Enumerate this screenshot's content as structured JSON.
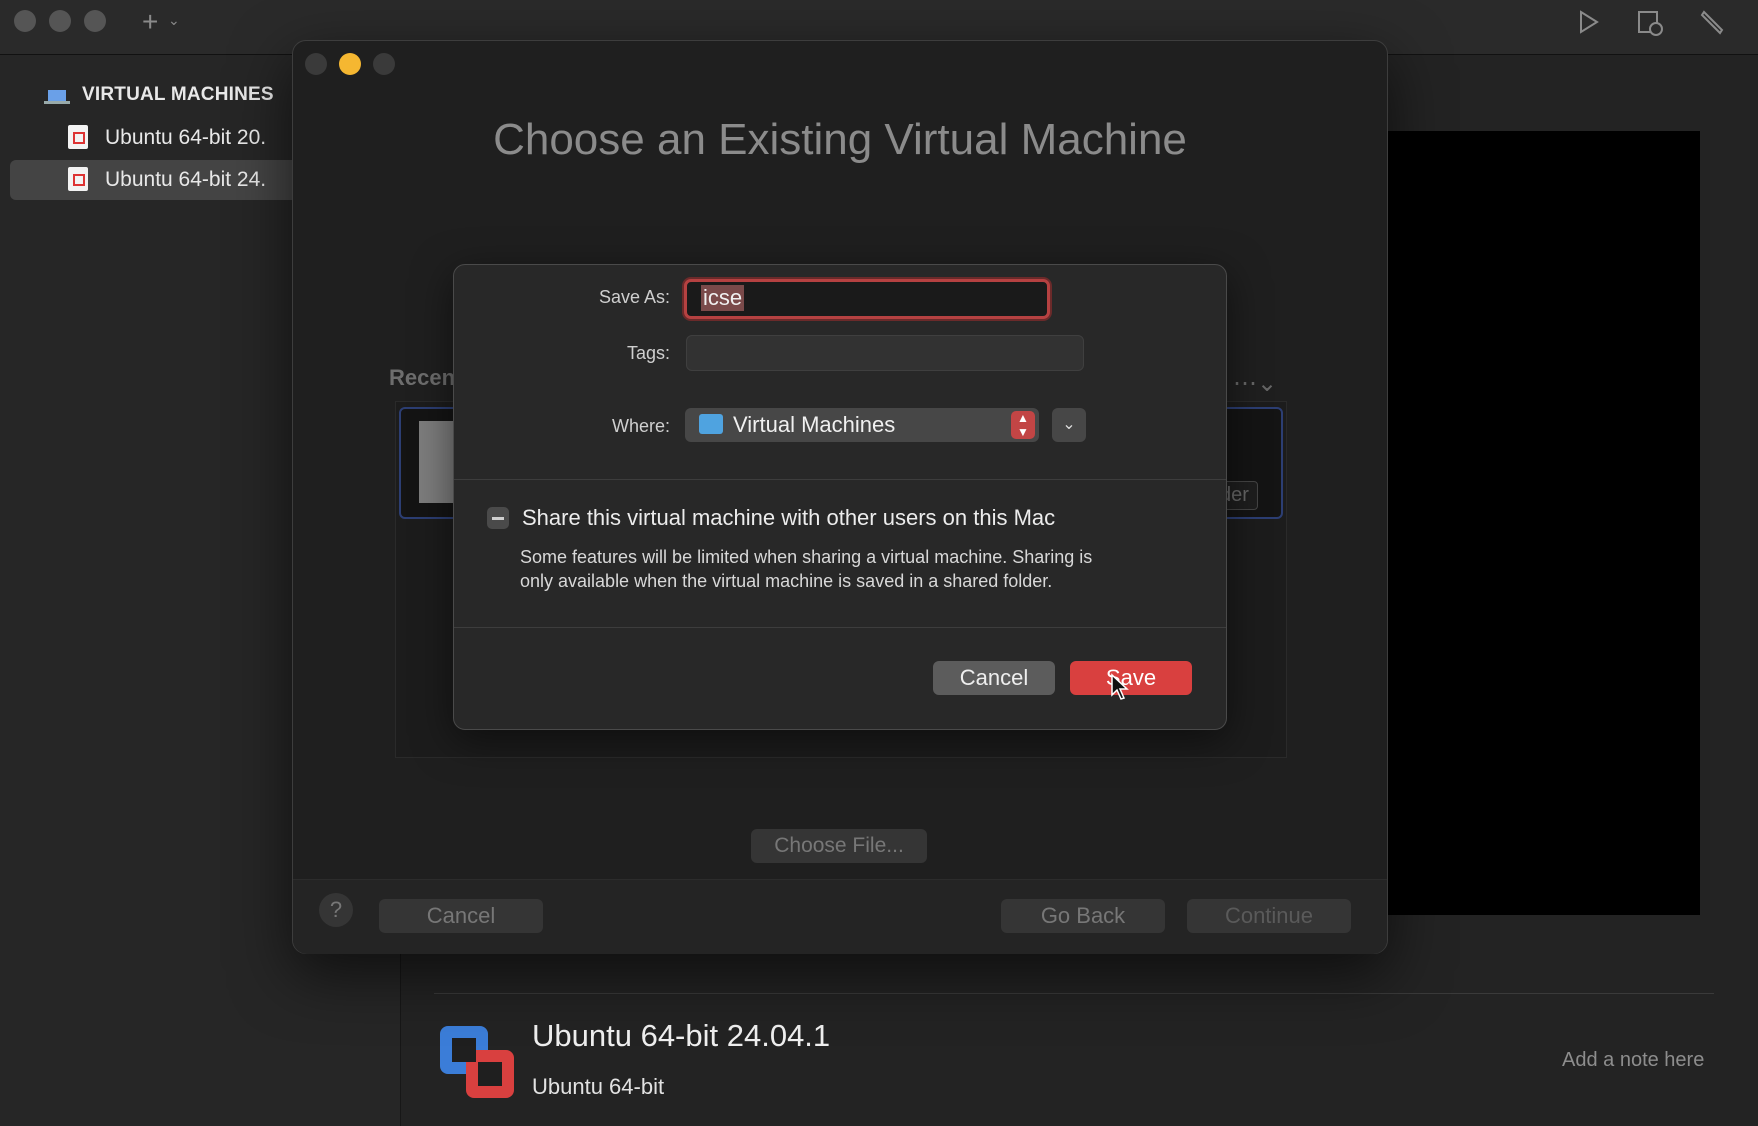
{
  "sidebar": {
    "header": "VIRTUAL MACHINES",
    "items": [
      {
        "label": "Ubuntu 64-bit 20."
      },
      {
        "label": "Ubuntu 64-bit 24."
      }
    ]
  },
  "details": {
    "vm_name": "Ubuntu 64-bit 24.04.1",
    "vm_os": "Ubuntu 64-bit",
    "note_placeholder": "Add a note here"
  },
  "assistant": {
    "title": "Choose an Existing Virtual Machine",
    "recent_label": "Recen",
    "finder_label": "der",
    "choose_file": "Choose File...",
    "help": "?",
    "cancel": "Cancel",
    "go_back": "Go Back",
    "continue": "Continue"
  },
  "save_sheet": {
    "save_as_label": "Save As:",
    "save_as_value": "icse",
    "tags_label": "Tags:",
    "where_label": "Where:",
    "where_value": "Virtual Machines",
    "share_label": "Share this virtual machine with other users on this Mac",
    "share_desc": "Some features will be limited when sharing a virtual machine. Sharing is only available when the virtual machine is saved in a shared folder.",
    "cancel": "Cancel",
    "save": "Save"
  },
  "colors": {
    "accent": "#d9403f",
    "folder": "#4fa3e0",
    "yellow_light": "#f5b731"
  },
  "icons": [
    "plus-icon",
    "chevron-down-icon",
    "play-icon",
    "snapshot-icon",
    "wrench-icon",
    "laptop-icon",
    "vm-document-icon",
    "folder-icon",
    "ellipsis-icon",
    "cursor-icon"
  ]
}
